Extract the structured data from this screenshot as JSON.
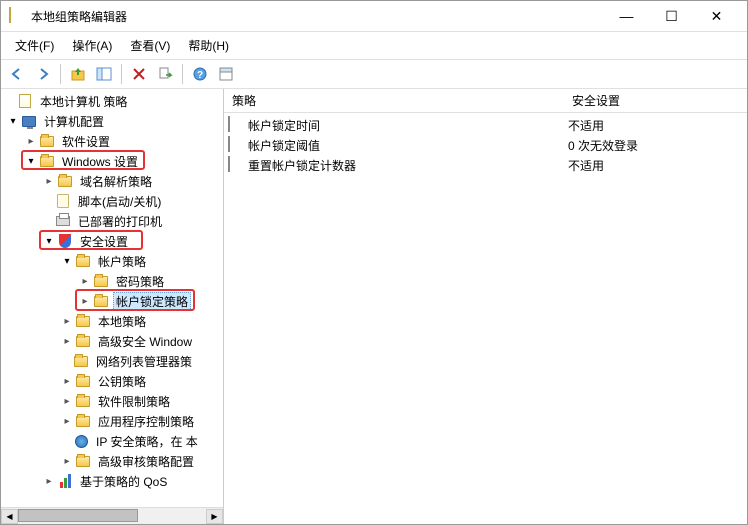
{
  "window": {
    "title": "本地组策略编辑器"
  },
  "buttons": {
    "min": "—",
    "max": "☐",
    "close": "✕"
  },
  "menu": {
    "file": "文件(F)",
    "action": "操作(A)",
    "view": "查看(V)",
    "help": "帮助(H)"
  },
  "tree": {
    "root": "本地计算机 策略",
    "computer": "计算机配置",
    "software": "软件设置",
    "windows": "Windows 设置",
    "dns": "域名解析策略",
    "script": "脚本(启动/关机)",
    "printer": "已部署的打印机",
    "security": "安全设置",
    "account": "帐户策略",
    "password": "密码策略",
    "lockout": "帐户锁定策略",
    "local": "本地策略",
    "firewall": "高级安全 Window",
    "netlist": "网络列表管理器策",
    "pubkey": "公钥策略",
    "softrestrict": "软件限制策略",
    "appctl": "应用程序控制策略",
    "ipsec": "IP 安全策略，在 本",
    "audit": "高级审核策略配置",
    "qos": "基于策略的 QoS"
  },
  "list": {
    "col1": "策略",
    "col2": "安全设置",
    "rows": [
      {
        "name": "帐户锁定时间",
        "value": "不适用"
      },
      {
        "name": "帐户锁定阈值",
        "value": "0 次无效登录"
      },
      {
        "name": "重置帐户锁定计数器",
        "value": "不适用"
      }
    ]
  }
}
